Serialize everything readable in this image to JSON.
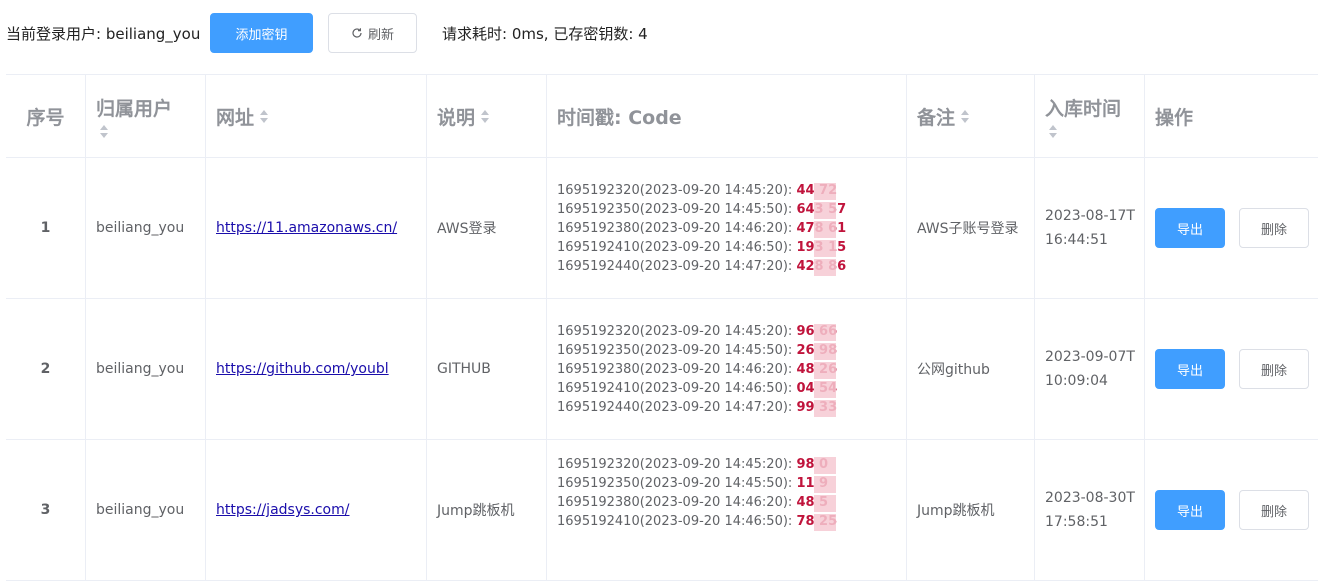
{
  "topbar": {
    "current_user_text": "当前登录用户: beiliang_you",
    "add_key_label": "添加密钥",
    "refresh_label": "刷新",
    "request_info": "请求耗时: 0ms, 已存密钥数: 4"
  },
  "table": {
    "headers": {
      "index": "序号",
      "owner": "归属用户",
      "url": "网址",
      "desc": "说明",
      "code": "时间戳: Code",
      "note": "备注",
      "stored_time": "入库时间",
      "actions": "操作"
    },
    "rows": [
      {
        "index": "1",
        "owner": "beiliang_you",
        "url": "https://11.amazonaws.cn/",
        "desc": "AWS登录",
        "codes": [
          {
            "ts": "1695192320(2023-09-20 14:45:20): ",
            "code": "44  72"
          },
          {
            "ts": "1695192350(2023-09-20 14:45:50): ",
            "code": "643  57"
          },
          {
            "ts": "1695192380(2023-09-20 14:46:20): ",
            "code": "478  61"
          },
          {
            "ts": "1695192410(2023-09-20 14:46:50): ",
            "code": "193  15"
          },
          {
            "ts": "1695192440(2023-09-20 14:47:20): ",
            "code": "428  86"
          }
        ],
        "note": "AWS子账号登录",
        "stored_date": "2023-08-17T",
        "stored_time": "16:44:51",
        "export_label": "导出",
        "delete_label": "删除"
      },
      {
        "index": "2",
        "owner": "beiliang_you",
        "url": "https://github.com/youbl",
        "desc": "GITHUB",
        "codes": [
          {
            "ts": "1695192320(2023-09-20 14:45:20): ",
            "code": "96  66"
          },
          {
            "ts": "1695192350(2023-09-20 14:45:50): ",
            "code": "26  98"
          },
          {
            "ts": "1695192380(2023-09-20 14:46:20): ",
            "code": "48  26"
          },
          {
            "ts": "1695192410(2023-09-20 14:46:50): ",
            "code": "04  54"
          },
          {
            "ts": "1695192440(2023-09-20 14:47:20): ",
            "code": "99  33"
          }
        ],
        "note": "公网github",
        "stored_date": "2023-09-07T",
        "stored_time": "10:09:04",
        "export_label": "导出",
        "delete_label": "删除"
      },
      {
        "index": "3",
        "owner": "beiliang_you",
        "url": "https://jadsys.com/",
        "desc": "Jump跳板机",
        "codes": [
          {
            "ts": "1695192320(2023-09-20 14:45:20): ",
            "code": "98  0"
          },
          {
            "ts": "1695192350(2023-09-20 14:45:50): ",
            "code": "11  9"
          },
          {
            "ts": "1695192380(2023-09-20 14:46:20): ",
            "code": "48  5"
          },
          {
            "ts": "1695192410(2023-09-20 14:46:50): ",
            "code": "78  25"
          }
        ],
        "note": "Jump跳板机",
        "stored_date": "2023-08-30T",
        "stored_time": "17:58:51",
        "export_label": "导出",
        "delete_label": "删除"
      }
    ]
  },
  "colors": {
    "primary": "#409eff",
    "code_red": "#c0143c",
    "mask_pink": "#f6c9d2"
  },
  "icons": {
    "refresh": "refresh-icon",
    "sort": "sort-caret-icon"
  }
}
